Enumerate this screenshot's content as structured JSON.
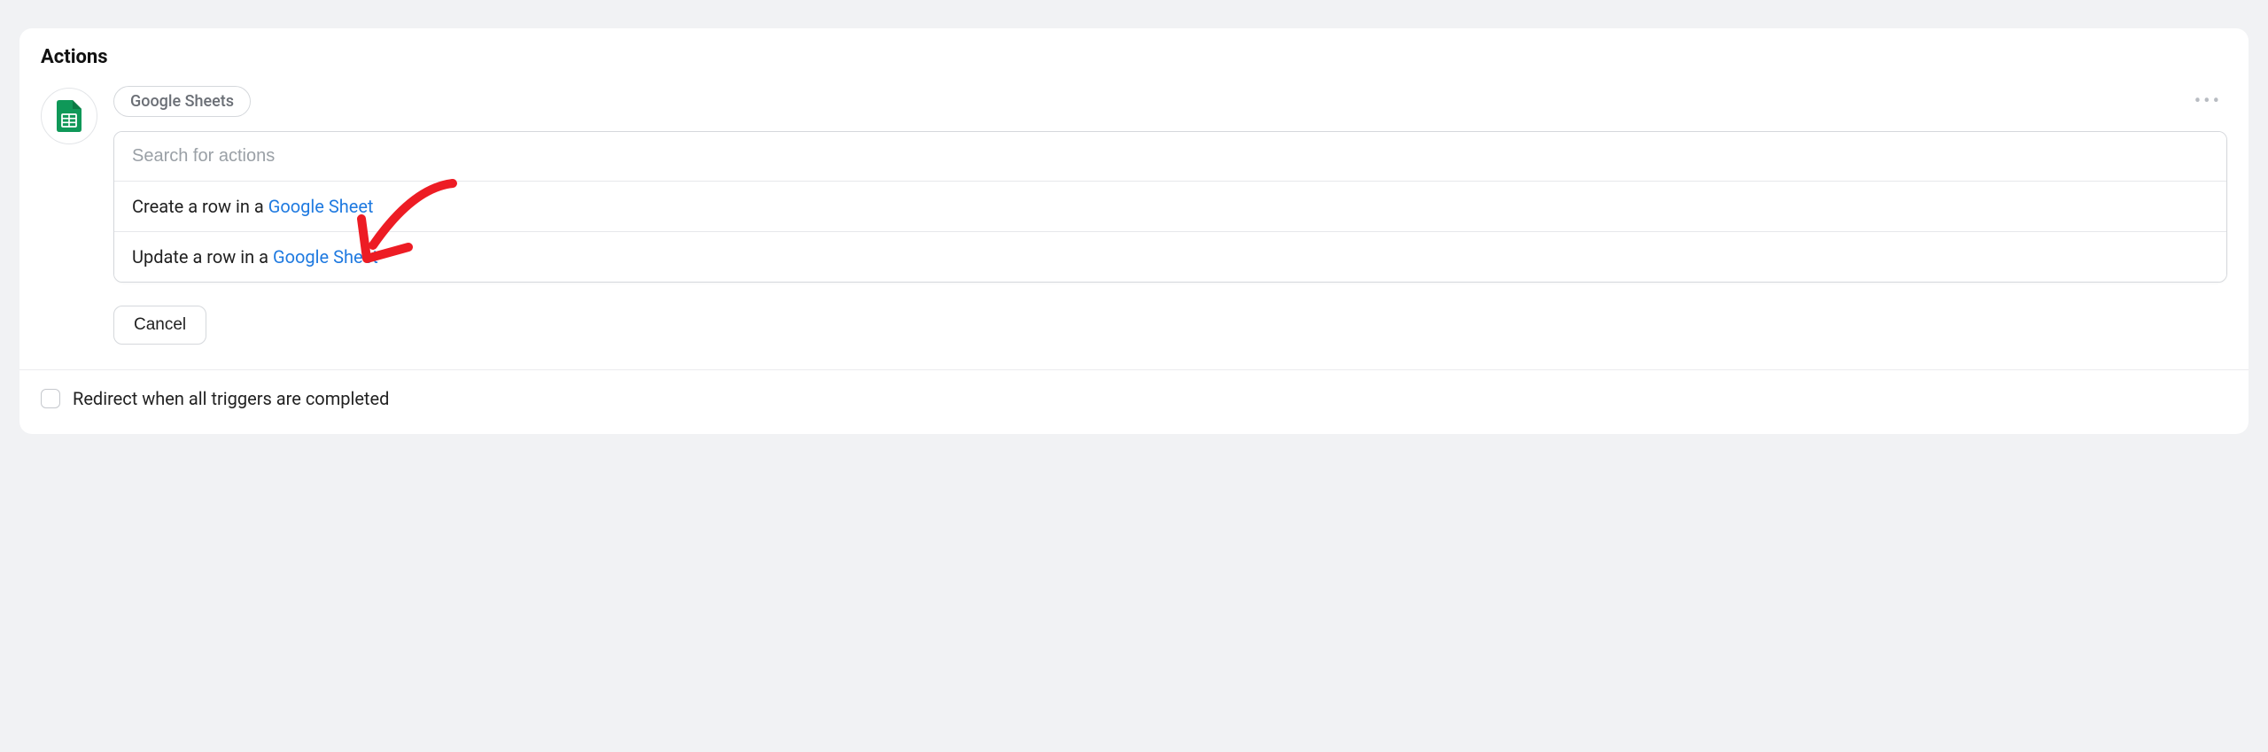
{
  "panel": {
    "title": "Actions"
  },
  "integration": {
    "chip_label": "Google Sheets",
    "icon_name": "google-sheets-icon"
  },
  "search": {
    "placeholder": "Search for actions",
    "value": ""
  },
  "options": [
    {
      "prefix": "Create a row in a ",
      "link": "Google Sheet"
    },
    {
      "prefix": "Update a row in a ",
      "link": "Google Sheet"
    }
  ],
  "buttons": {
    "cancel": "Cancel"
  },
  "redirect": {
    "label": "Redirect when all triggers are completed",
    "checked": false
  },
  "colors": {
    "link": "#1f7ae0",
    "sheets_green": "#0f9858",
    "annotation_red": "#ed1c24"
  }
}
